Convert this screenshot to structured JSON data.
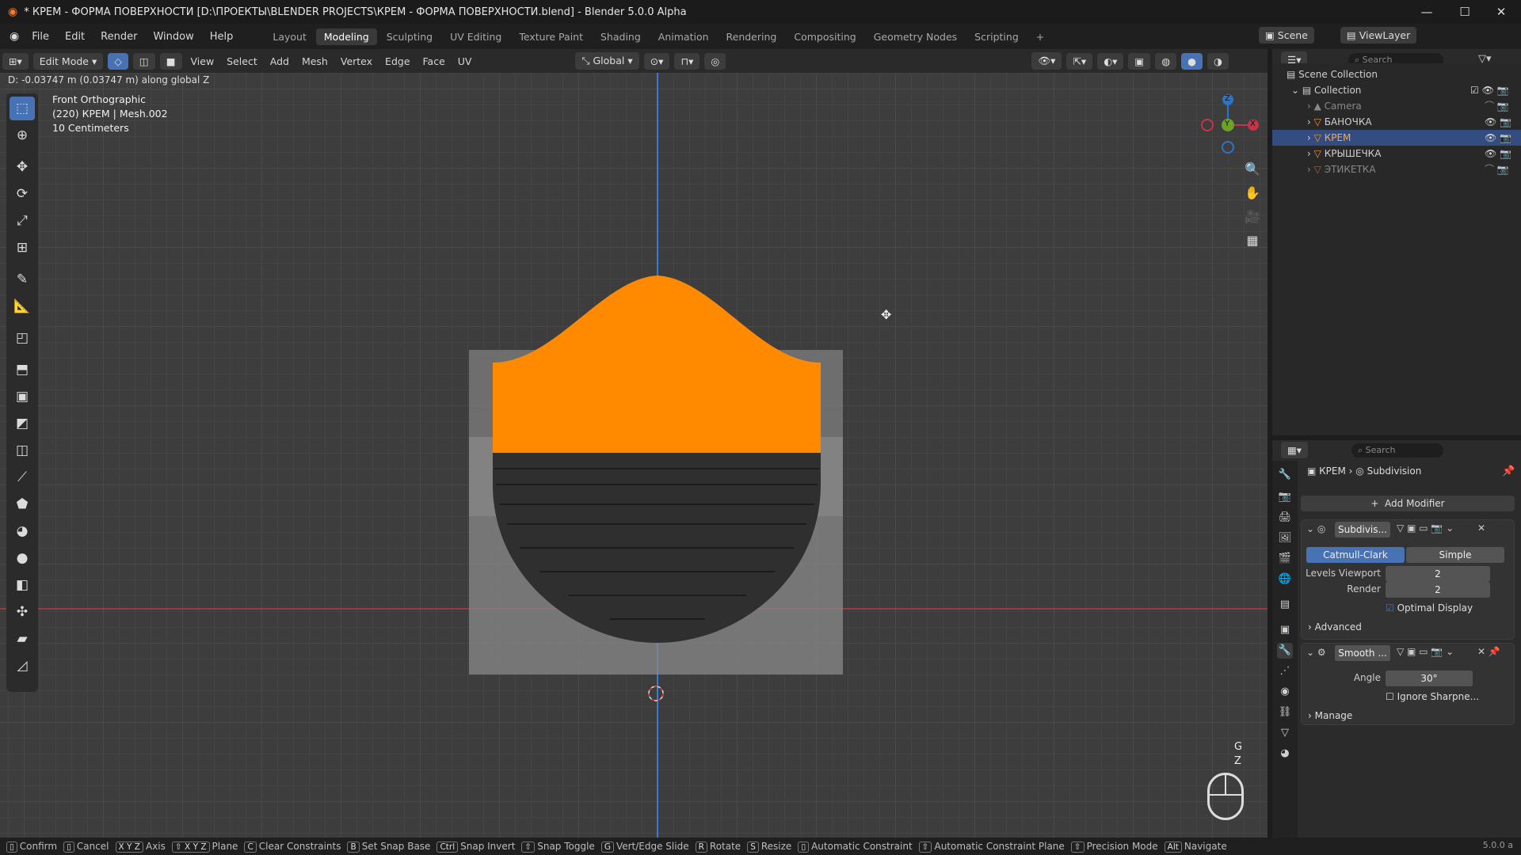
{
  "window": {
    "title": "* КРЕМ - ФОРМА ПОВЕРХНОСТИ [D:\\ПРОЕКТЫ\\BLENDER PROJECTS\\КРЕМ - ФОРМА ПОВЕРХНОСТИ.blend] - Blender 5.0.0 Alpha"
  },
  "menu": [
    "File",
    "Edit",
    "Render",
    "Window",
    "Help"
  ],
  "workspaces": [
    "Layout",
    "Modeling",
    "Sculpting",
    "UV Editing",
    "Texture Paint",
    "Shading",
    "Animation",
    "Rendering",
    "Compositing",
    "Geometry Nodes",
    "Scripting"
  ],
  "active_workspace": "Modeling",
  "scene": {
    "label": "Scene",
    "viewlayer": "ViewLayer"
  },
  "viewport_header": {
    "mode": "Edit Mode",
    "menus": [
      "View",
      "Select",
      "Add",
      "Mesh",
      "Vertex",
      "Edge",
      "Face",
      "UV"
    ],
    "orientation": "Global"
  },
  "status_msg": "D: -0.03747 m (0.03747 m) along global Z",
  "overlay": {
    "view": "Front Orthographic",
    "object": "(220) КРЕМ | Mesh.002",
    "scale": "10 Centimeters"
  },
  "gizmo": {
    "x": "X",
    "y": "Y",
    "z": "Z"
  },
  "hint_keys": {
    "g": "G",
    "z": "Z"
  },
  "outliner": {
    "search_placeholder": "Search",
    "scene_collection": "Scene Collection",
    "collection": "Collection",
    "items": [
      {
        "name": "Camera",
        "dim": true
      },
      {
        "name": "БАНОЧКА",
        "dim": false
      },
      {
        "name": "КРЕМ",
        "dim": false,
        "selected": true
      },
      {
        "name": "КРЫШЕЧКА",
        "dim": false
      },
      {
        "name": "ЭТИКЕТКА",
        "dim": true
      }
    ]
  },
  "properties": {
    "search_placeholder": "Search",
    "breadcrumb_obj": "КРЕМ",
    "breadcrumb_mod": "Subdivision",
    "add_modifier": "Add Modifier",
    "subdiv": {
      "name": "Subdivis...",
      "catmull": "Catmull-Clark",
      "simple": "Simple",
      "levels_label": "Levels Viewport",
      "levels": "2",
      "render_label": "Render",
      "render": "2",
      "optimal": "Optimal Display",
      "advanced": "Advanced"
    },
    "smooth": {
      "name": "Smooth ...",
      "angle_label": "Angle",
      "angle": "30°",
      "ignore": "Ignore Sharpne...",
      "manage": "Manage"
    }
  },
  "statusbar": [
    {
      "k": "",
      "t": "Confirm"
    },
    {
      "k": "",
      "t": "Cancel"
    },
    {
      "k": "X Y Z",
      "t": "Axis"
    },
    {
      "k": "⇧ X Y Z",
      "t": "Plane"
    },
    {
      "k": "C",
      "t": "Clear Constraints"
    },
    {
      "k": "B",
      "t": "Set Snap Base"
    },
    {
      "k": "Ctrl",
      "t": "Snap Invert"
    },
    {
      "k": "⇧",
      "t": "Snap Toggle"
    },
    {
      "k": "G",
      "t": "Vert/Edge Slide"
    },
    {
      "k": "R",
      "t": "Rotate"
    },
    {
      "k": "S",
      "t": "Resize"
    },
    {
      "k": "",
      "t": "Automatic Constraint"
    },
    {
      "k": "⇧",
      "t": "Automatic Constraint Plane"
    },
    {
      "k": "⇧",
      "t": "Precision Mode"
    },
    {
      "k": "Alt",
      "t": "Navigate"
    }
  ],
  "version": "5.0.0 a",
  "colors": {
    "accent": "#4772b3",
    "orange": "#ff8a00",
    "x_axis": "#c7344a",
    "y_axis": "#6ba227",
    "z_axis": "#2c74c7"
  }
}
